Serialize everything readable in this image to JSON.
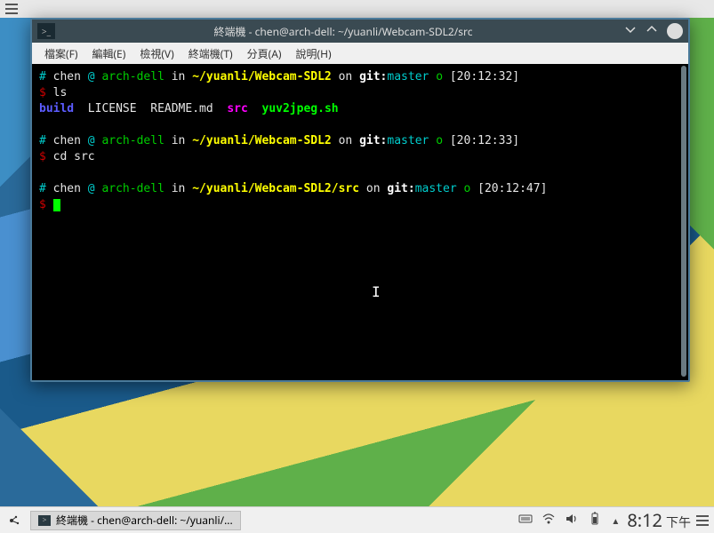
{
  "window": {
    "title": "終端機 - chen@arch-dell: ~/yuanli/Webcam-SDL2/src",
    "icon_glyph": ">_"
  },
  "menu": {
    "file": "檔案(F)",
    "edit": "編輯(E)",
    "view": "檢視(V)",
    "terminal": "終端機(T)",
    "tabs": "分頁(A)",
    "help": "說明(H)"
  },
  "prompts": [
    {
      "user": "chen",
      "host": "arch-dell",
      "path": "~/yuanli/Webcam-SDL2",
      "branch": "master",
      "status": "o",
      "time": "[20:12:32]",
      "command": "ls"
    },
    {
      "user": "chen",
      "host": "arch-dell",
      "path": "~/yuanli/Webcam-SDL2",
      "branch": "master",
      "status": "o",
      "time": "[20:12:33]",
      "command": "cd src"
    },
    {
      "user": "chen",
      "host": "arch-dell",
      "path": "~/yuanli/Webcam-SDL2/src",
      "branch": "master",
      "status": "o",
      "time": "[20:12:47]",
      "command": ""
    }
  ],
  "tokens": {
    "hash": "#",
    "at": "@",
    "in": "in",
    "on": "on",
    "git": "git:",
    "dollar": "$"
  },
  "ls_output": {
    "build": "build",
    "license": "LICENSE",
    "readme": "README.md",
    "src": "src",
    "script": "yuv2jpeg.sh"
  },
  "taskbar": {
    "task_label": "終端機 - chen@arch-dell: ~/yuanli/...",
    "clock_time": "8:12",
    "clock_ampm": "下午"
  }
}
